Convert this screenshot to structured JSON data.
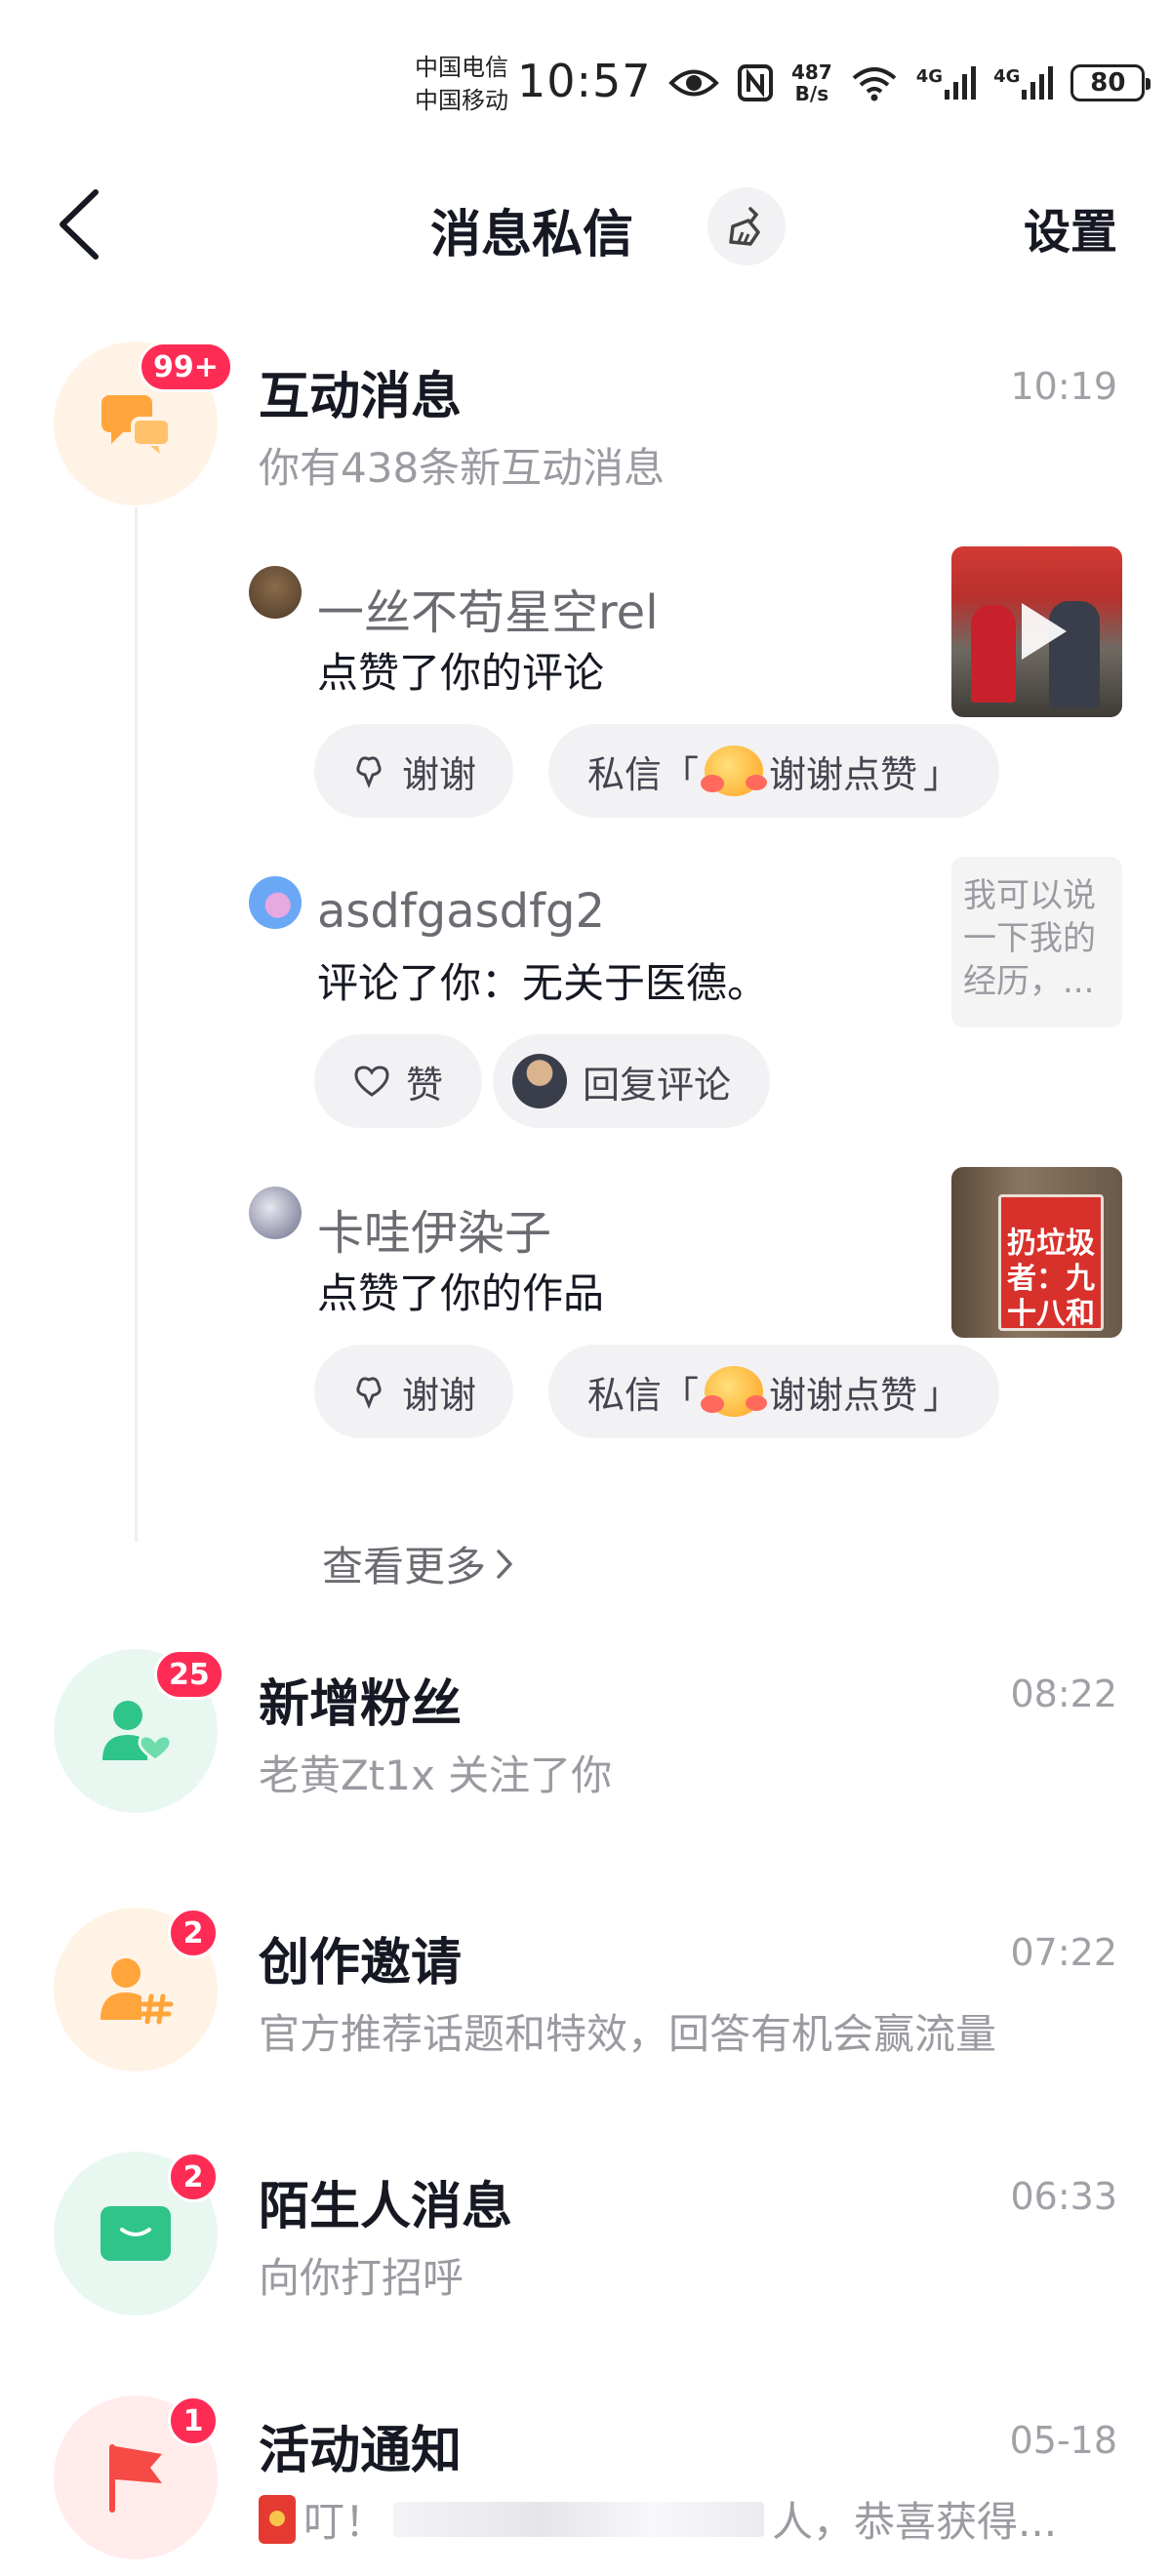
{
  "status_bar": {
    "carrier_1": "中国电信",
    "carrier_2": "中国移动",
    "time": "10:57",
    "net_speed_value": "487",
    "net_speed_unit": "B/s",
    "signal_1_label": "4G",
    "signal_2_label": "4G",
    "battery": "80",
    "icons": [
      "eye-icon",
      "nfc-icon",
      "wifi-icon",
      "signal-icon",
      "signal-icon",
      "battery-icon"
    ]
  },
  "nav": {
    "title": "消息私信",
    "settings_label": "设置",
    "back_icon": "chevron-left-icon",
    "clean_icon": "broom-icon"
  },
  "interaction": {
    "title": "互动消息",
    "badge": "99+",
    "time": "10:19",
    "subtitle": "你有438条新互动消息",
    "items": [
      {
        "user": "一丝不苟星空rel",
        "action": "点赞了你的评论",
        "actions": [
          {
            "icon": "flower-icon",
            "label": "谢谢"
          },
          {
            "prefix": "私信「",
            "label": "谢谢点赞",
            "suffix": "」"
          }
        ]
      },
      {
        "user": "asdfgasdfg2",
        "action": "评论了你：无关于医德。",
        "thumb_text": "我可以说一下我的经历，...",
        "actions": [
          {
            "icon": "heart-outline-icon",
            "label": "赞"
          },
          {
            "label": "回复评论"
          }
        ]
      },
      {
        "user": "卡哇伊染子",
        "action": "点赞了你的作品",
        "thumb_text": "扔垃圾者：九十八和一",
        "actions": [
          {
            "icon": "flower-icon",
            "label": "谢谢"
          },
          {
            "prefix": "私信「",
            "label": "谢谢点赞",
            "suffix": "」"
          }
        ]
      }
    ],
    "see_more": "查看更多"
  },
  "rows": [
    {
      "title": "新增粉丝",
      "badge": "25",
      "time": "08:22",
      "subtitle": "老黄Zt1x 关注了你",
      "icon": "user-heart-icon",
      "bg": "#e8f8f1",
      "color": "#2fc48a"
    },
    {
      "title": "创作邀请",
      "badge": "2",
      "time": "07:22",
      "subtitle": "官方推荐话题和特效，回答有机会赢流量",
      "icon": "user-hashtag-icon",
      "bg": "#fff3e6",
      "color": "#ffa53b"
    },
    {
      "title": "陌生人消息",
      "badge": "2",
      "time": "06:33",
      "subtitle": "向你打招呼",
      "icon": "envelope-icon",
      "bg": "#e8f8f1",
      "color": "#2fc48a"
    },
    {
      "title": "活动通知",
      "badge": "1",
      "time": "05-18",
      "subtitle_prefix": "叮！",
      "subtitle_suffix": "人，恭喜获得...",
      "icon": "flag-icon",
      "bg": "#ffeceb",
      "color": "#f54a45"
    }
  ],
  "colors": {
    "badge": "#fe2c55",
    "interaction_icon": "#ffa53b",
    "interaction_bg": "#fff3e6"
  }
}
